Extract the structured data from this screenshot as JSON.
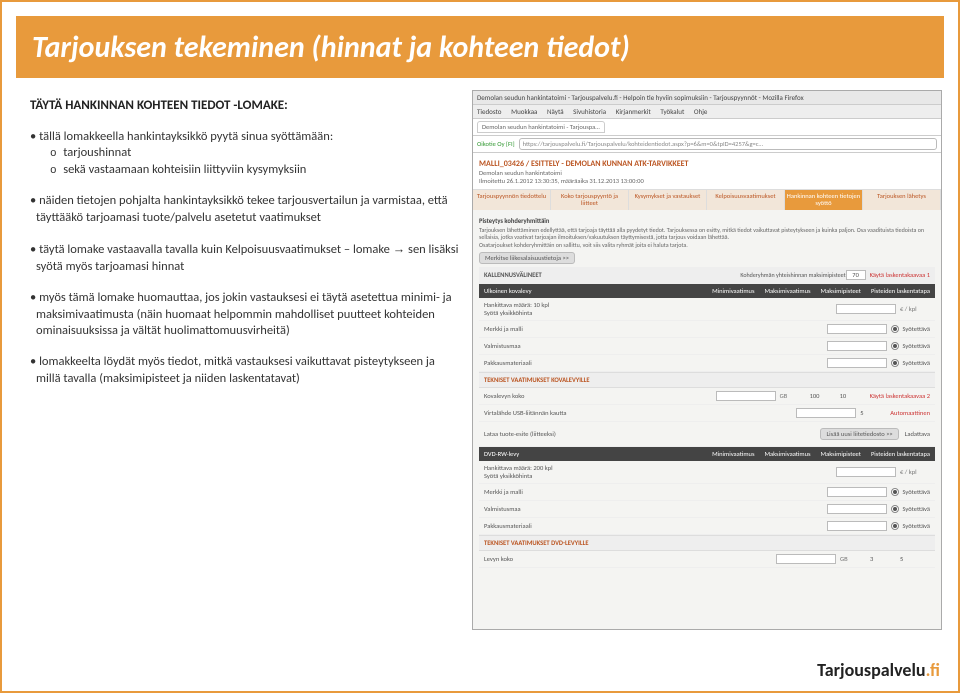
{
  "title": "Tarjouksen tekeminen (hinnat ja kohteen tiedot)",
  "subhead": "TÄYTÄ HANKINNAN KOHTEEN TIEDOT -LOMAKE:",
  "bullets": {
    "b1": "tällä lomakkeella hankintayksikkö pyytä sinua syöttämään:",
    "b1a": "tarjoushinnat",
    "b1b": "sekä vastaamaan kohteisiin liittyviin kysymyksiin",
    "b2": "näiden tietojen pohjalta hankintayksikkö tekee tarjousvertailun ja varmistaa, että täyttääkö tarjoamasi tuote/palvelu asetetut vaatimukset",
    "b3a": "täytä lomake vastaavalla tavalla kuin Kelpoisuusvaatimukset – lomake ",
    "b3arrow": "→",
    "b3b": " sen lisäksi syötä myös tarjoamasi hinnat",
    "b4": "myös tämä lomake huomauttaa, jos jokin vastauksesi ei täytä asetettua minimi- ja maksimivaatimusta (näin huomaat helpommin mahdolliset puutteet kohteiden ominaisuuksissa ja vältät huolimattomuusvirheitä)",
    "b5": "lomakkeelta löydät myös tiedot, mitkä vastauksesi vaikuttavat pisteytykseen ja millä tavalla (maksimipisteet ja niiden laskentatavat)"
  },
  "ss": {
    "windowTitle": "Demolan seudun hankintatoimi - Tarjouspalvelu.fi - Helpoin tie hyviin sopimuksiin - Tarjouspyynnöt - Mozilla Firefox",
    "menu": [
      "Tiedosto",
      "Muokkaa",
      "Näytä",
      "Sivuhistoria",
      "Kirjanmerkit",
      "Työkalut",
      "Ohje"
    ],
    "tabLabel": "Demolan seudun hankintatoimi - Tarjouspa…",
    "url": "https://tarjouspalvelu.fi/Tarjouspalvelu/kohteidentiedot.aspx?p=6&m=0&tpID=4257&g=c…",
    "crumb": "Oikotie Oy [FI]",
    "hname": "MALLI_03426 / ESITTELY - DEMOLAN KUNNAN ATK-TARVIKKEET",
    "sub": "Demolan seudun hankintatoimi",
    "dates": "Ilmoitettu 26.1.2012 13:30:35, määräaika 31.12.2013 13:00:00",
    "tabs": [
      "Tarjouspyynnön tiedottelu",
      "Koko tarjouspyyntö ja liitteet",
      "Kysymykset ja vastaukset",
      "Kelpoisuusvaatimukset",
      "Hankinnan kohteen tietojen syöttö",
      "Tarjouksen lähetys"
    ],
    "activeTab": 4,
    "sect1": "Pisteytys kohderyhmittäin",
    "desc1": "Tarjouksen lähettäminen edellyttää, että tarjoaja täyttää alla pyydetyt tiedot. Tarjouksessa on esitty, mitkä tiedot vaikuttavat pisteytykseen ja kuinka paljon. Osa vaadituista tiedoista on sellaisia, jotka vaativat tarjoajan ilmoituksen/vakuutuksen täyttymisestä, jotta tarjous voidaan lähettää.",
    "desc1b": "Osatarjoukset kohderyhmittäin on sallittu, voit siis valita ryhmät joita ei haluta tarjota.",
    "btn1": "Merkitse liikesalaisuustietoja >>",
    "bar1": "KALLENNUSVÄLINEET",
    "bar1b": "Kohderyhmän yhteishinnan maksimipisteet",
    "bar1c": "70",
    "bar1d": "Käytä laskentakaavaa 1",
    "darkcols": [
      "Ulkoinen kovalevy",
      "Minimivaatimus",
      "Maksimivaatimus",
      "Maksimipisteet",
      "Pisteiden laskentatapa"
    ],
    "rows1": [
      {
        "lbl": "Hankittava määrä: 10 kpl\nSyötä yksikköhinta",
        "unit": "€ / kpl"
      },
      {
        "lbl": "Merkki ja malli",
        "radio": true,
        "rtxt": "Syötettävä"
      },
      {
        "lbl": "Valmistusmaa",
        "radio": true,
        "rtxt": "Syötettävä"
      },
      {
        "lbl": "Pakkausmateriaali",
        "radio": true,
        "rtxt": "Syötettävä"
      }
    ],
    "sect2": "TEKNISET VAATIMUKSET KOVALEVYILLE",
    "rows2": [
      {
        "lbl": "Kovalevyn koko",
        "unit": "GB",
        "min": "100",
        "max": "10",
        "link": "Käytä laskentakaavaa 2"
      },
      {
        "lbl": "Virtalähde USB-liitännän kautta",
        "min": "5",
        "link": "Automaattinen"
      },
      {
        "lbl": "Lataa tuote-esite (liitteeksi)",
        "btn1": "Lisää uusi liitetiedosto >>",
        "btn2": "Ladattava"
      }
    ],
    "dark2": [
      "DVD-RW-levy",
      "",
      "Minimivaatimus",
      "Maksimivaatimus",
      "Maksimipisteet",
      "Pisteiden laskentatapa"
    ],
    "rows3": [
      {
        "lbl": "Hankittava määrä: 200 kpl\nSyötä yksikköhinta",
        "unit": "€ / kpl"
      },
      {
        "lbl": "Merkki ja malli",
        "radio": true,
        "rtxt": "Syötettävä"
      },
      {
        "lbl": "Valmistusmaa",
        "radio": true,
        "rtxt": "Syötettävä"
      },
      {
        "lbl": "Pakkausmateriaali",
        "radio": true,
        "rtxt": "Syötettävä"
      }
    ],
    "sect3": "TEKNISET VAATIMUKSET DVD-LEVYILLE",
    "rows4": [
      {
        "lbl": "Levyn koko",
        "unit": "GB",
        "min": "3",
        "max": "5"
      }
    ]
  },
  "logo": {
    "a": "Tarjouspalvelu",
    "b": ".fi"
  }
}
